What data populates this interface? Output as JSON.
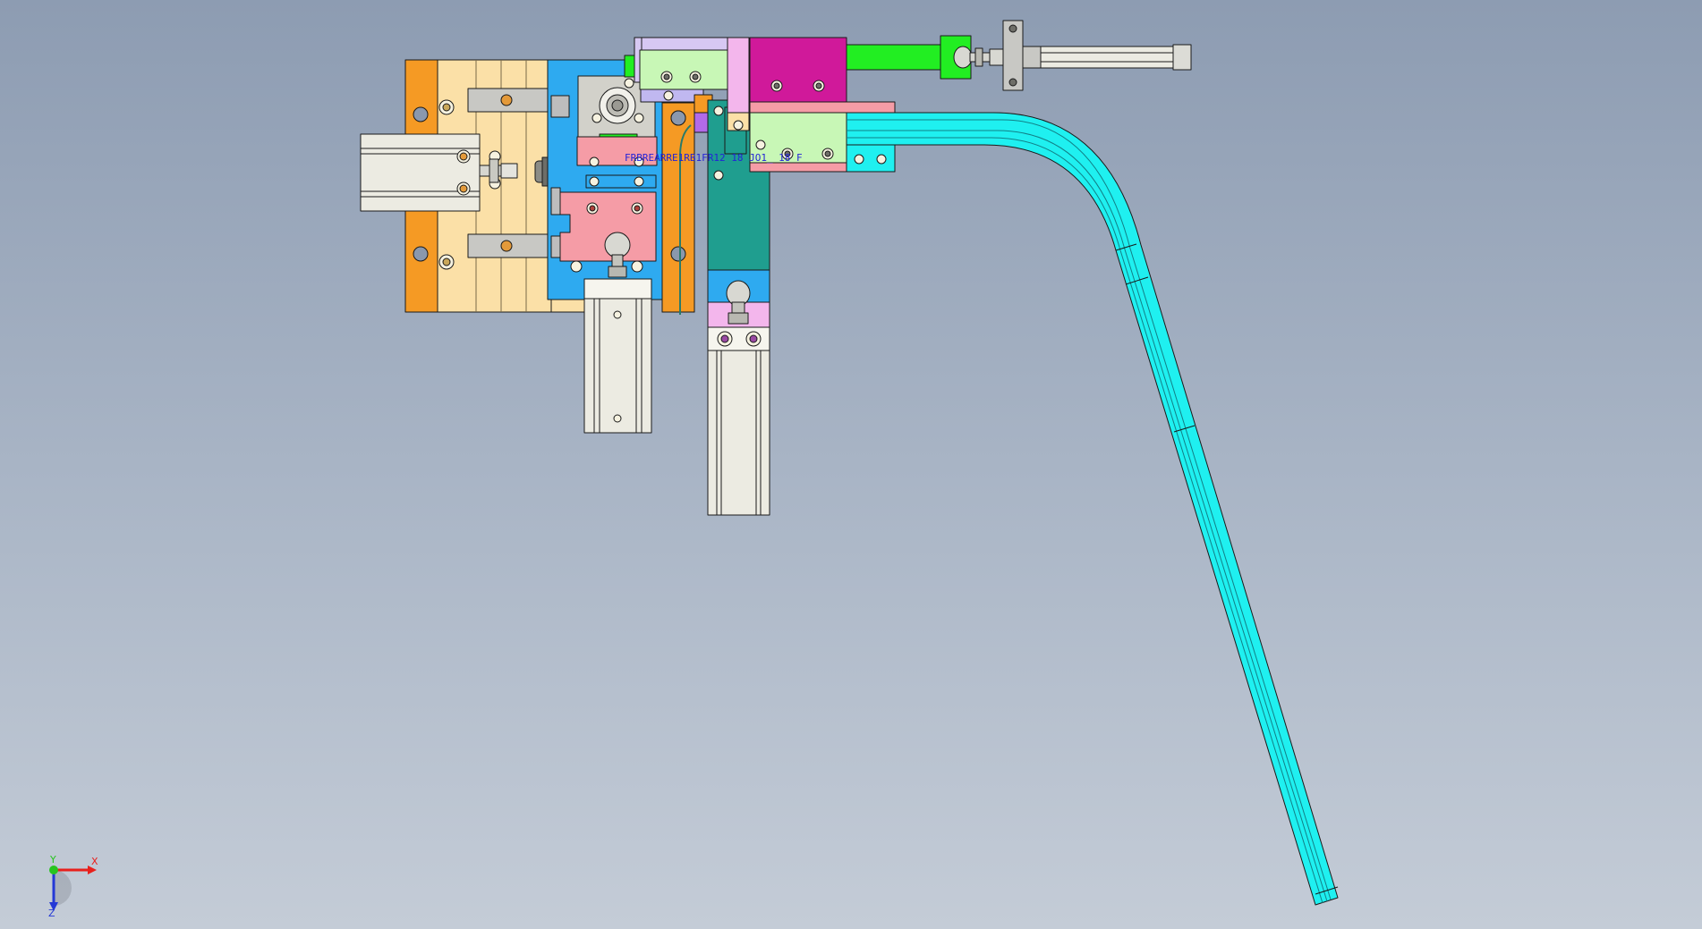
{
  "viewport": {
    "background_top": "#8d9cb2",
    "background_bottom": "#c4ccd7"
  },
  "model": {
    "annotation_text": "FRBREARRE1RB1FR12 18 JO1_ 18 F"
  },
  "triad": {
    "x_label": "X",
    "y_label": "Y",
    "z_label": "Z",
    "x_color": "#e8201c",
    "y_color": "#27c41f",
    "z_color": "#2439d6"
  }
}
